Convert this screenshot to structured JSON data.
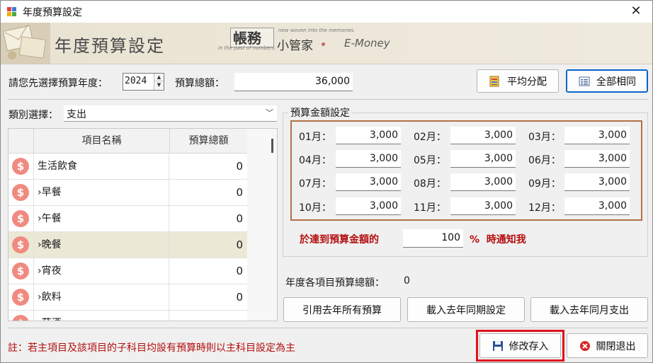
{
  "window": {
    "title": "年度預算設定",
    "close_glyph": "✕"
  },
  "banner": {
    "title": "年度預算設定",
    "logo_main": "帳務",
    "logo_tag1": "new woven into the memories.",
    "logo_tag2": "in the past of numbers.",
    "logo_sub": "小管家",
    "logo_en": "E-Money"
  },
  "top": {
    "year_label": "請您先選擇預算年度：",
    "year_value": "2024",
    "total_label": "預算總額：",
    "total_value": "36,000",
    "avg_button": "平均分配",
    "same_button": "全部相同"
  },
  "category": {
    "label": "類別選擇：",
    "value": "支出"
  },
  "grid": {
    "headers": [
      "項目名稱",
      "預算總額"
    ],
    "rows": [
      {
        "name": "生活飲食",
        "amount": "0",
        "selected": false
      },
      {
        "name": "›早餐",
        "amount": "0",
        "selected": false
      },
      {
        "name": "›午餐",
        "amount": "0",
        "selected": false
      },
      {
        "name": "›晚餐",
        "amount": "0",
        "selected": true
      },
      {
        "name": "›宵夜",
        "amount": "0",
        "selected": false
      },
      {
        "name": "›飲料",
        "amount": "0",
        "selected": false
      },
      {
        "name": "›菸酒",
        "amount": "",
        "selected": false
      }
    ]
  },
  "budget": {
    "group_title": "預算金額設定",
    "months": [
      {
        "label": "01月：",
        "value": "3,000"
      },
      {
        "label": "02月：",
        "value": "3,000"
      },
      {
        "label": "03月：",
        "value": "3,000"
      },
      {
        "label": "04月：",
        "value": "3,000"
      },
      {
        "label": "05月：",
        "value": "3,000"
      },
      {
        "label": "06月：",
        "value": "3,000"
      },
      {
        "label": "07月：",
        "value": "3,000"
      },
      {
        "label": "08月：",
        "value": "3,000"
      },
      {
        "label": "09月：",
        "value": "3,000"
      },
      {
        "label": "10月：",
        "value": "3,000"
      },
      {
        "label": "11月：",
        "value": "3,000"
      },
      {
        "label": "12月：",
        "value": "3,000"
      }
    ],
    "alert_prefix": "於達到預算金額的",
    "alert_value": "100",
    "alert_suffix": "%  時通知我"
  },
  "summary": {
    "label": "年度各項目預算總額：",
    "value": "0"
  },
  "load_buttons": {
    "use_last_year": "引用去年所有預算",
    "load_last_setting": "載入去年同期設定",
    "load_last_expense": "載入去年同月支出"
  },
  "footer": {
    "note": "註：若主項目及該項目的子科目均設有預算時則以主科目設定為主",
    "save_button": "修改存入",
    "close_button": "關閉退出"
  },
  "colors": {
    "accent_red": "#b40e0e",
    "highlight_border": "#e0111b",
    "months_border": "#b2704a",
    "dollar_icon": "#f08a80",
    "selected_row": "#ebe8d6"
  }
}
